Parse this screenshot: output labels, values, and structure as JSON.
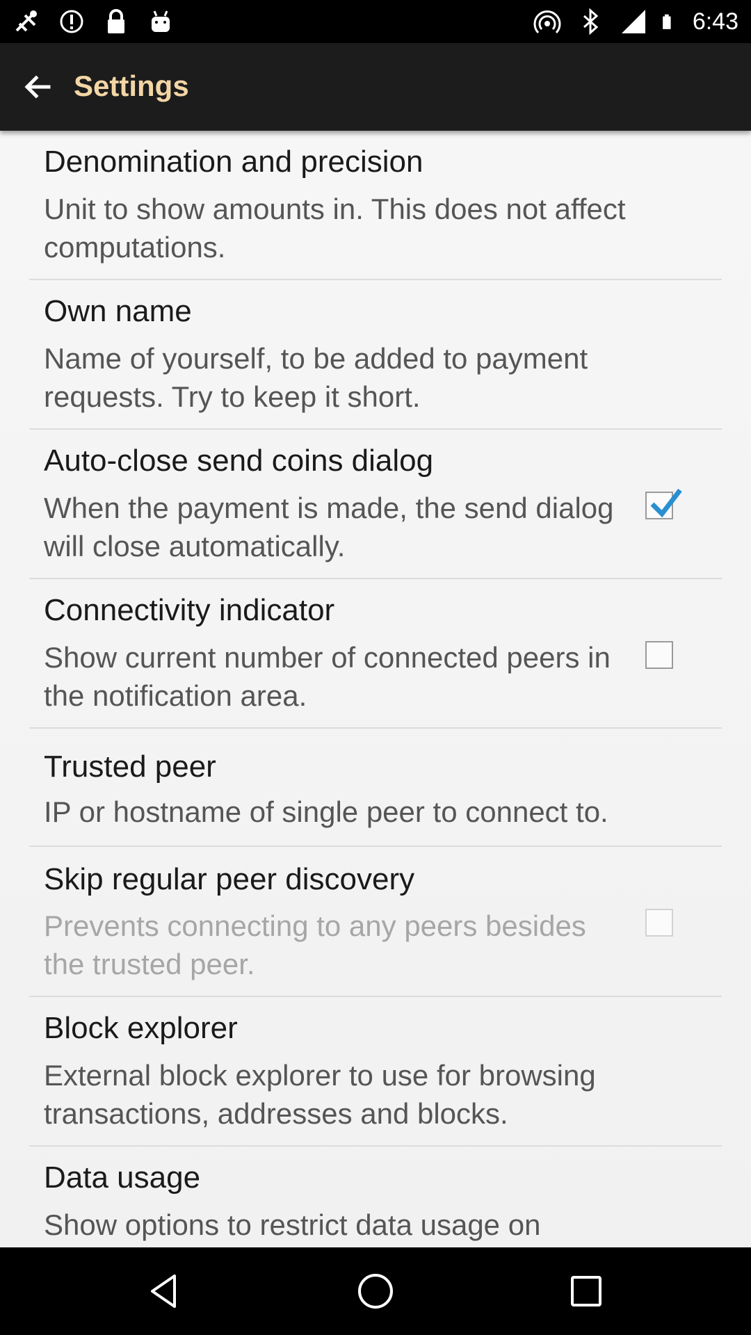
{
  "status_bar": {
    "time": "6:43",
    "icons_left": [
      "fax-icon",
      "sync-icon",
      "lock-icon",
      "android-icon"
    ],
    "icons_right": [
      "hotspot-icon",
      "bluetooth-icon",
      "signal-icon",
      "battery-icon"
    ]
  },
  "app_bar": {
    "title": "Settings",
    "back_icon": "arrow-left-icon",
    "title_color": "#f3d6a6",
    "background": "#1c1c1c"
  },
  "preferences": [
    {
      "title": "Denomination and precision",
      "summary": "Unit to show amounts in. This does not affect computations."
    },
    {
      "title": "Own name",
      "summary": "Name of yourself, to be added to payment requests. Try to keep it short."
    },
    {
      "title": "Auto-close send coins dialog",
      "summary": "When the payment is made, the send dialog will close automatically.",
      "checkbox": true,
      "checked": true
    },
    {
      "title": "Connectivity indicator",
      "summary": "Show current number of connected peers in the notification area.",
      "checkbox": true,
      "checked": false
    },
    {
      "title": "Trusted peer",
      "summary": "IP or hostname of single peer to connect to."
    },
    {
      "title": "Skip regular peer discovery",
      "summary": "Prevents connecting to any peers besides the trusted peer.",
      "checkbox": true,
      "checked": false,
      "enabled": false
    },
    {
      "title": "Block explorer",
      "summary": "External block explorer to use for browsing transactions, addresses and blocks."
    },
    {
      "title": "Data usage",
      "summary": "Show options to restrict data usage on"
    }
  ],
  "nav_bar": {
    "buttons": [
      "back-triangle-icon",
      "home-circle-icon",
      "recents-square-icon"
    ]
  },
  "colors": {
    "accent_check": "#2a8fd1",
    "title_text": "#1a1a1a",
    "summary_text": "#555555",
    "disabled_text": "#a6a6a6"
  }
}
